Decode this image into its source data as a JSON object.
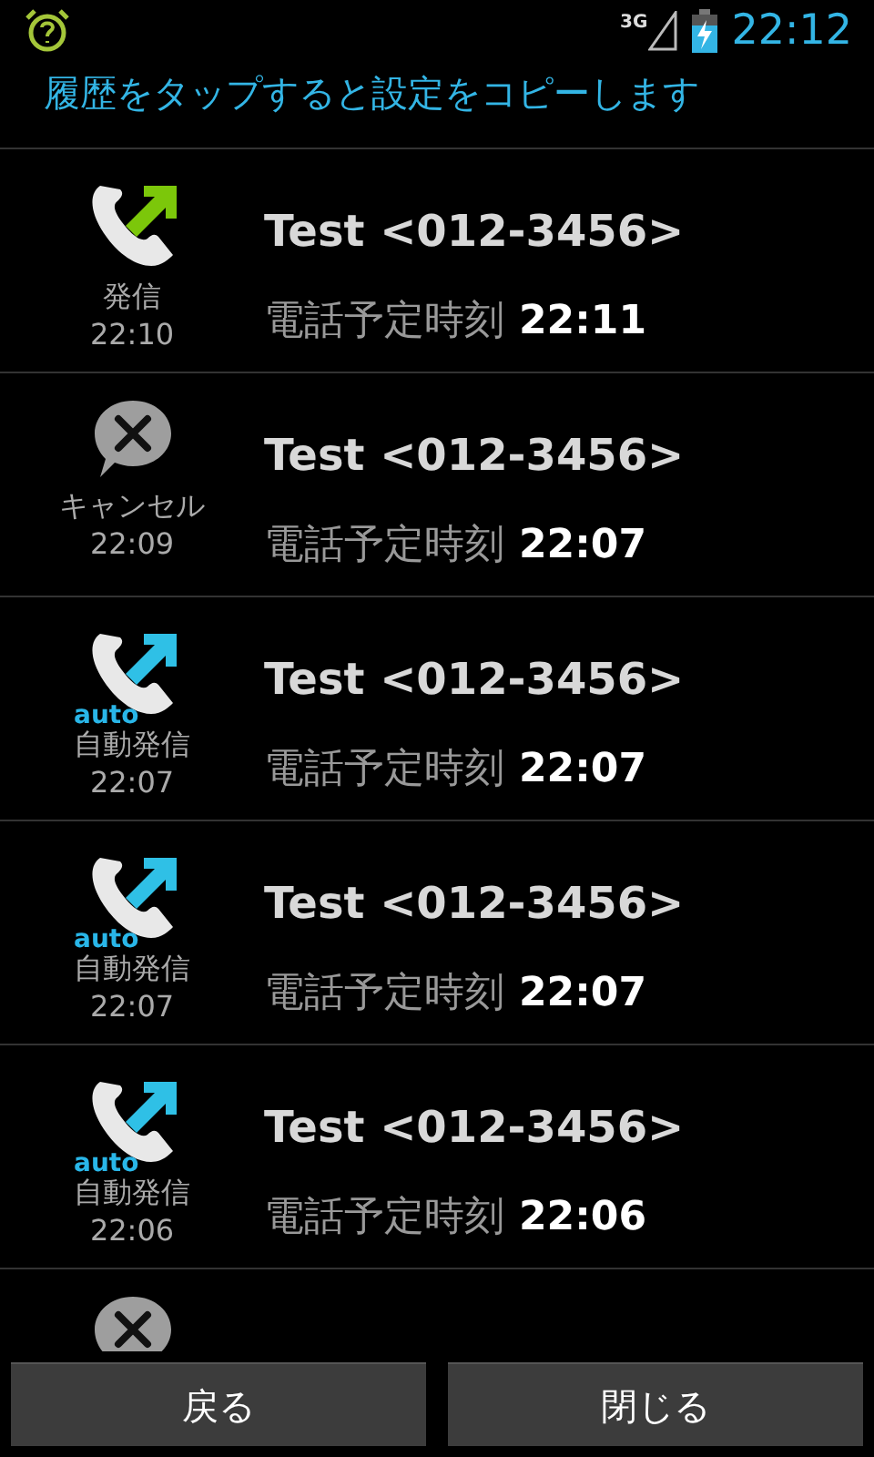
{
  "status_bar": {
    "network": "3G",
    "time": "22:12"
  },
  "header": {
    "text": "履歴をタップすると設定をコピーします"
  },
  "history": [
    {
      "kind": "outgoing",
      "label": "発信",
      "time": "22:10",
      "name": "Test <012-3456>",
      "scheduled_label": "電話予定時刻",
      "scheduled_time": "22:11"
    },
    {
      "kind": "cancel",
      "label": "キャンセル",
      "time": "22:09",
      "name": "Test <012-3456>",
      "scheduled_label": "電話予定時刻",
      "scheduled_time": "22:07"
    },
    {
      "kind": "auto",
      "badge": "auto",
      "label": "自動発信",
      "time": "22:07",
      "name": "Test <012-3456>",
      "scheduled_label": "電話予定時刻",
      "scheduled_time": "22:07"
    },
    {
      "kind": "auto",
      "badge": "auto",
      "label": "自動発信",
      "time": "22:07",
      "name": "Test <012-3456>",
      "scheduled_label": "電話予定時刻",
      "scheduled_time": "22:07"
    },
    {
      "kind": "auto",
      "badge": "auto",
      "label": "自動発信",
      "time": "22:06",
      "name": "Test <012-3456>",
      "scheduled_label": "電話予定時刻",
      "scheduled_time": "22:06"
    },
    {
      "kind": "cancel"
    }
  ],
  "buttons": [
    "戻る",
    "閉じる"
  ]
}
